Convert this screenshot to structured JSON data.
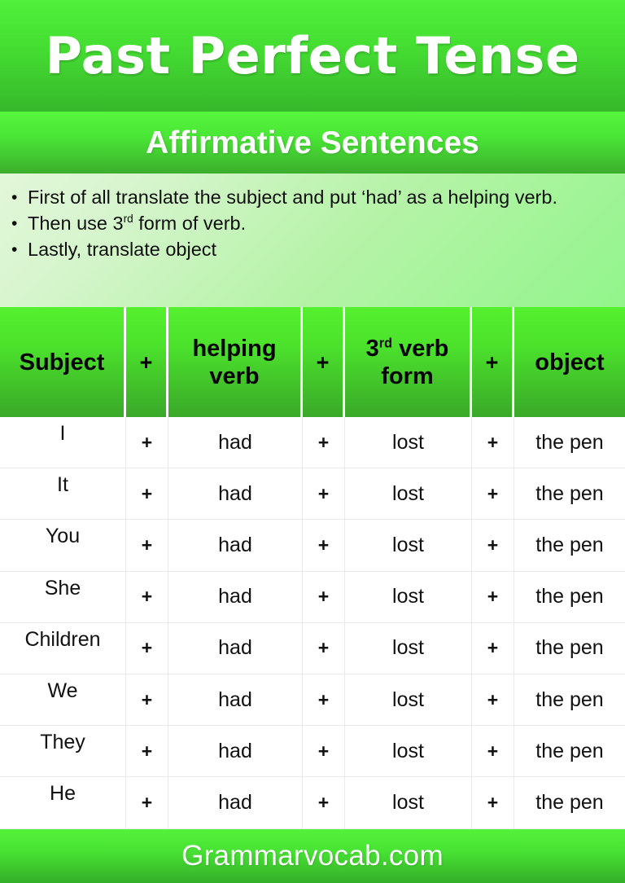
{
  "header": {
    "title": "Past Perfect Tense",
    "subtitle": "Affirmative Sentences"
  },
  "rules": {
    "items": [
      {
        "text_before": "First of all translate the subject and put ‘had’ as a helping verb.",
        "sup": "",
        "text_after": ""
      },
      {
        "text_before": "Then use 3",
        "sup": "rd",
        "text_after": " form of verb."
      },
      {
        "text_before": "Lastly, translate object",
        "sup": "",
        "text_after": ""
      }
    ]
  },
  "table": {
    "headers": {
      "subject": "Subject",
      "plus_1": "+",
      "helping_verb": "helping verb",
      "helping_verb_line1": "helping",
      "helping_verb_line2": "verb",
      "plus_2": "+",
      "verb_form_prefix": "3",
      "verb_form_sup": "rd",
      "verb_form_line1_rest": " verb",
      "verb_form_line2": "form",
      "plus_3": "+",
      "object": "object"
    },
    "rows": [
      {
        "subject": "I",
        "plus_1": "+",
        "helping_verb": "had",
        "plus_2": "+",
        "verb_form": "lost",
        "plus_3": "+",
        "object": "the pen"
      },
      {
        "subject": "It",
        "plus_1": "+",
        "helping_verb": "had",
        "plus_2": "+",
        "verb_form": "lost",
        "plus_3": "+",
        "object": "the pen"
      },
      {
        "subject": "You",
        "plus_1": "+",
        "helping_verb": "had",
        "plus_2": "+",
        "verb_form": "lost",
        "plus_3": "+",
        "object": "the pen"
      },
      {
        "subject": "She",
        "plus_1": "+",
        "helping_verb": "had",
        "plus_2": "+",
        "verb_form": "lost",
        "plus_3": "+",
        "object": "the pen"
      },
      {
        "subject": "Children",
        "plus_1": "+",
        "helping_verb": "had",
        "plus_2": "+",
        "verb_form": "lost",
        "plus_3": "+",
        "object": "the pen"
      },
      {
        "subject": "We",
        "plus_1": "+",
        "helping_verb": "had",
        "plus_2": "+",
        "verb_form": "lost",
        "plus_3": "+",
        "object": "the pen"
      },
      {
        "subject": "They",
        "plus_1": "+",
        "helping_verb": "had",
        "plus_2": "+",
        "verb_form": "lost",
        "plus_3": "+",
        "object": "the pen"
      },
      {
        "subject": "He",
        "plus_1": "+",
        "helping_verb": "had",
        "plus_2": "+",
        "verb_form": "lost",
        "plus_3": "+",
        "object": "the pen"
      }
    ]
  },
  "footer": {
    "site": "Grammarvocab.com"
  },
  "colors": {
    "banner_green_light": "#50f03c",
    "banner_green_dark": "#37b82b",
    "subtitle_green_light": "#57f63e",
    "subtitle_green_dark": "#3cae2d",
    "rules_bg_light": "#e2f7d9",
    "rules_bg_dark": "#92f58b",
    "header_row_light": "#55f02f",
    "header_row_dark": "#3aa829",
    "footer_light": "#54f23a",
    "footer_dark": "#35ae29",
    "text_dark": "#111111",
    "text_white": "#ffffff"
  }
}
